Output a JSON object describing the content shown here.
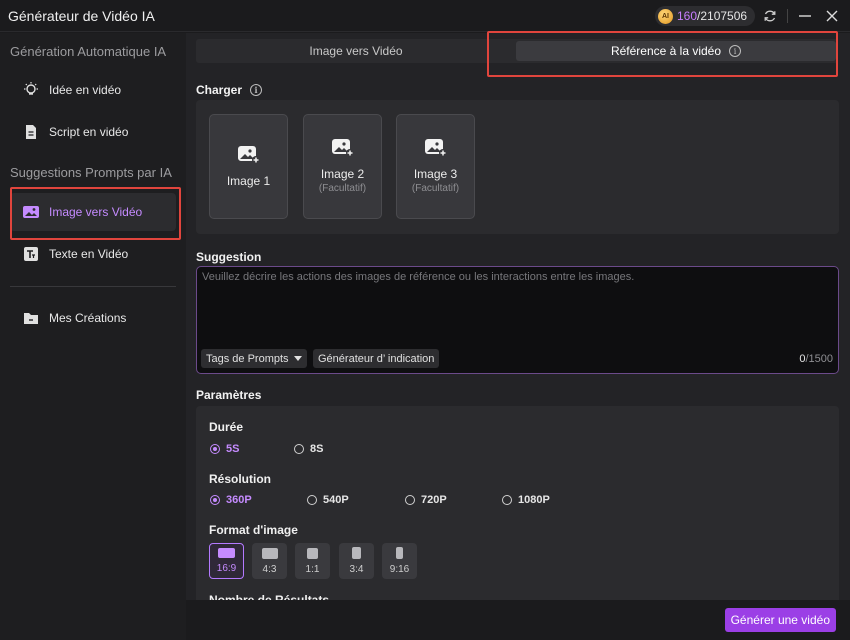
{
  "app": {
    "title": "Générateur de Vidéo IA",
    "credits_used": "160",
    "credits_total": "/2107506",
    "coin_label": "AI"
  },
  "sidebar": {
    "section_auto": "Génération Automatique IA",
    "section_prompts": "Suggestions Prompts par IA",
    "items": [
      {
        "label": "Idée en vidéo",
        "icon": "lightbulb-icon"
      },
      {
        "label": "Script en vidéo",
        "icon": "document-icon"
      },
      {
        "label": "Image vers Vidéo",
        "icon": "image-icon",
        "active": true
      },
      {
        "label": "Texte en Vidéo",
        "icon": "text-icon"
      },
      {
        "label": "Mes Créations",
        "icon": "folder-icon"
      }
    ]
  },
  "tabs": [
    {
      "label": "Image vers Vidéo",
      "active": false
    },
    {
      "label": "Référence à la vidéo",
      "active": true
    }
  ],
  "upload": {
    "label": "Charger",
    "cards": [
      {
        "label": "Image 1",
        "sub": ""
      },
      {
        "label": "Image 2",
        "sub": "(Facultatif)"
      },
      {
        "label": "Image 3",
        "sub": "(Facultatif)"
      }
    ]
  },
  "suggestion": {
    "label": "Suggestion",
    "placeholder": "Veuillez décrire les actions des images de référence ou les interactions entre les images.",
    "tags_button": "Tags de Prompts",
    "generator_button": "Générateur d’ indication",
    "count_current": "0",
    "count_max": "/1500"
  },
  "parameters": {
    "title": "Paramètres",
    "duration": {
      "label": "Durée",
      "options": [
        "5S",
        "8S"
      ],
      "selected": "5S"
    },
    "resolution": {
      "label": "Résolution",
      "options": [
        "360P",
        "540P",
        "720P",
        "1080P"
      ],
      "selected": "360P"
    },
    "aspect": {
      "label": "Format d'image",
      "options": [
        "16:9",
        "4:3",
        "1:1",
        "3:4",
        "9:16"
      ],
      "selected": "16:9"
    },
    "results_label": "Nombre de Résultats"
  },
  "footer": {
    "generate_button": "Générer une vidéo"
  },
  "colors": {
    "accent": "#c58bff",
    "button": "#9b3fe6",
    "highlight": "#e1453d"
  }
}
